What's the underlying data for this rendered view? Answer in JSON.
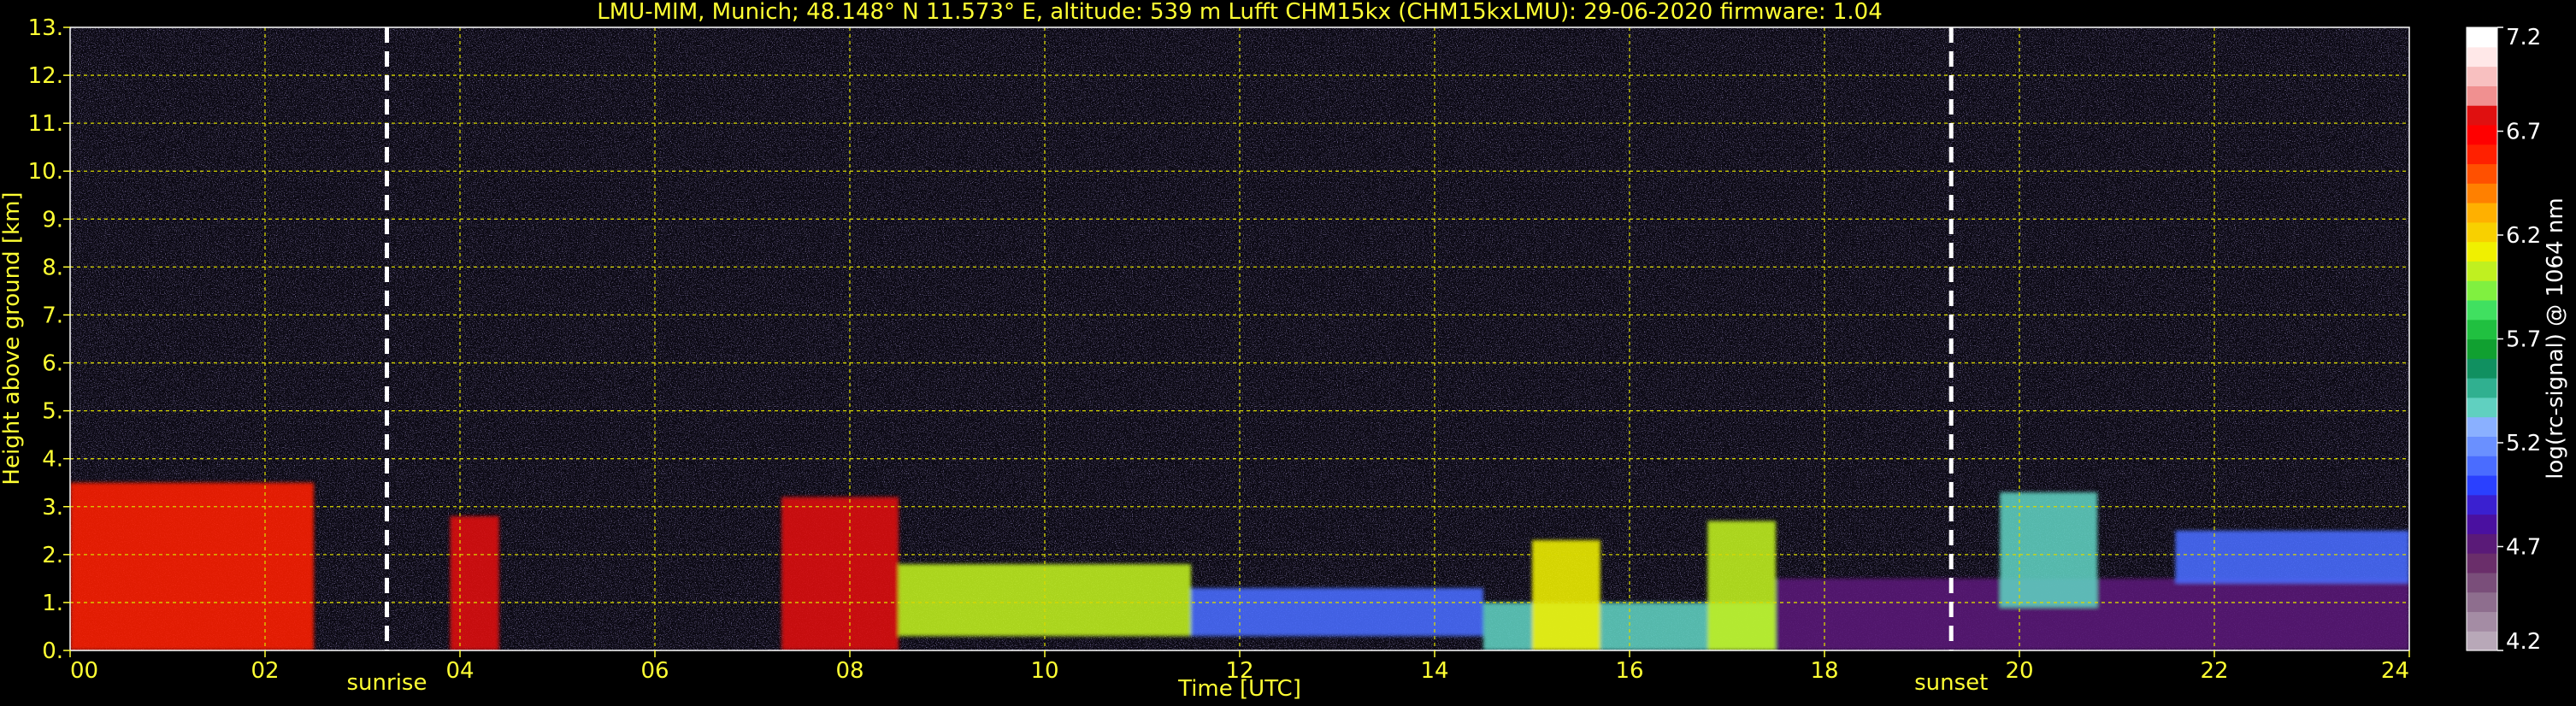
{
  "chart_data": {
    "type": "heatmap",
    "title": "LMU-MIM, Munich; 48.148° N 11.573° E, altitude: 539 m    Lufft CHM15kx (CHM15kxLMU): 29-06-2020    firmware: 1.04",
    "xlabel": "Time [UTC]",
    "ylabel": "Height above ground [km]",
    "xlim": [
      0,
      24
    ],
    "ylim": [
      0,
      13
    ],
    "x_ticks": [
      "00",
      "02",
      "04",
      "06",
      "08",
      "10",
      "12",
      "14",
      "16",
      "18",
      "20",
      "22",
      "24"
    ],
    "y_ticks": [
      "0.",
      "1.",
      "2.",
      "3.",
      "4.",
      "5.",
      "6.",
      "7.",
      "8.",
      "9.",
      "10.",
      "11.",
      "12.",
      "13."
    ],
    "grid": true,
    "annotations": [
      {
        "text": "sunrise",
        "x": 3.25
      },
      {
        "text": "sunset",
        "x": 19.3
      }
    ],
    "colorbar": {
      "label": "log(rc-signal) @ 1064 nm",
      "min": 4.2,
      "max": 7.2,
      "ticks": [
        "4.2",
        "4.7",
        "5.2",
        "5.7",
        "6.2",
        "6.7",
        "7.2"
      ],
      "colors": [
        "#b8a8b8",
        "#a48ca4",
        "#8e6e8e",
        "#7a4e7a",
        "#6a2e6a",
        "#5a1a78",
        "#4a10a0",
        "#3a20d0",
        "#2a40ff",
        "#4a6cff",
        "#6a90ff",
        "#8ab0ff",
        "#60d0c0",
        "#30b090",
        "#109060",
        "#10a030",
        "#20c040",
        "#40e060",
        "#80f040",
        "#c0f020",
        "#f0f000",
        "#f8d000",
        "#ffb000",
        "#ff8000",
        "#ff5000",
        "#ff2000",
        "#ff0000",
        "#e01010",
        "#f09090",
        "#f8c0c0",
        "#ffe8e8",
        "#ffffff"
      ]
    },
    "layers": [
      {
        "x_range": [
          0,
          2.5
        ],
        "height_range": [
          0,
          3.5
        ],
        "level": 6.6
      },
      {
        "x_range": [
          3.9,
          4.4
        ],
        "height_range": [
          0,
          2.8
        ],
        "level": 6.8
      },
      {
        "x_range": [
          7.3,
          8.5
        ],
        "height_range": [
          0,
          3.2
        ],
        "level": 6.8
      },
      {
        "x_range": [
          8.5,
          11.5
        ],
        "height_range": [
          0.3,
          1.8
        ],
        "level": 6.0
      },
      {
        "x_range": [
          11.5,
          14.5
        ],
        "height_range": [
          0.3,
          1.3
        ],
        "level": 5.1
      },
      {
        "x_range": [
          14.5,
          17.5
        ],
        "height_range": [
          0,
          1.0
        ],
        "level": 5.4
      },
      {
        "x_range": [
          15.0,
          15.7
        ],
        "height_range": [
          0,
          2.3
        ],
        "level": 6.1
      },
      {
        "x_range": [
          16.8,
          17.5
        ],
        "height_range": [
          0,
          2.7
        ],
        "level": 6.0
      },
      {
        "x_range": [
          17.5,
          24
        ],
        "height_range": [
          0,
          1.5
        ],
        "level": 4.7
      },
      {
        "x_range": [
          19.8,
          20.8
        ],
        "height_range": [
          0.9,
          3.3
        ],
        "level": 5.4
      },
      {
        "x_range": [
          21.6,
          24
        ],
        "height_range": [
          1.4,
          2.5
        ],
        "level": 5.1
      }
    ]
  }
}
